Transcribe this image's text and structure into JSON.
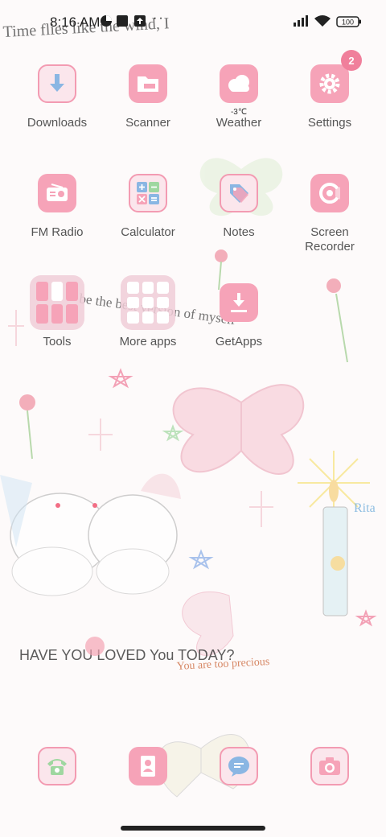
{
  "status_bar": {
    "time": "8:16 AM",
    "battery": "100"
  },
  "apps": [
    {
      "id": "downloads",
      "label": "Downloads"
    },
    {
      "id": "scanner",
      "label": "Scanner"
    },
    {
      "id": "weather",
      "label": "Weather",
      "temperature": "-3℃"
    },
    {
      "id": "settings",
      "label": "Settings",
      "badge": "2"
    },
    {
      "id": "fm-radio",
      "label": "FM Radio"
    },
    {
      "id": "calculator",
      "label": "Calculator"
    },
    {
      "id": "notes",
      "label": "Notes"
    },
    {
      "id": "screen-recorder",
      "label": "Screen\nRecorder"
    },
    {
      "id": "tools",
      "label": "Tools"
    },
    {
      "id": "more-apps",
      "label": "More apps"
    },
    {
      "id": "getapps",
      "label": "GetApps"
    }
  ],
  "dock": [
    {
      "id": "phone",
      "icon": "phone-icon"
    },
    {
      "id": "contacts",
      "icon": "contacts-icon"
    },
    {
      "id": "messages",
      "icon": "messages-icon"
    },
    {
      "id": "camera",
      "icon": "camera-icon"
    }
  ],
  "wallpaper": {
    "text_1": "Time flies like the wind, I",
    "text_2": "be the best version of myself",
    "text_3": "HAVE YOU LOVED You TODAY?",
    "text_4": "You are too precious",
    "text_5": "Rita"
  },
  "colors": {
    "accent": "#f6a3b8",
    "badge": "#f07f9b",
    "text": "#555555"
  }
}
